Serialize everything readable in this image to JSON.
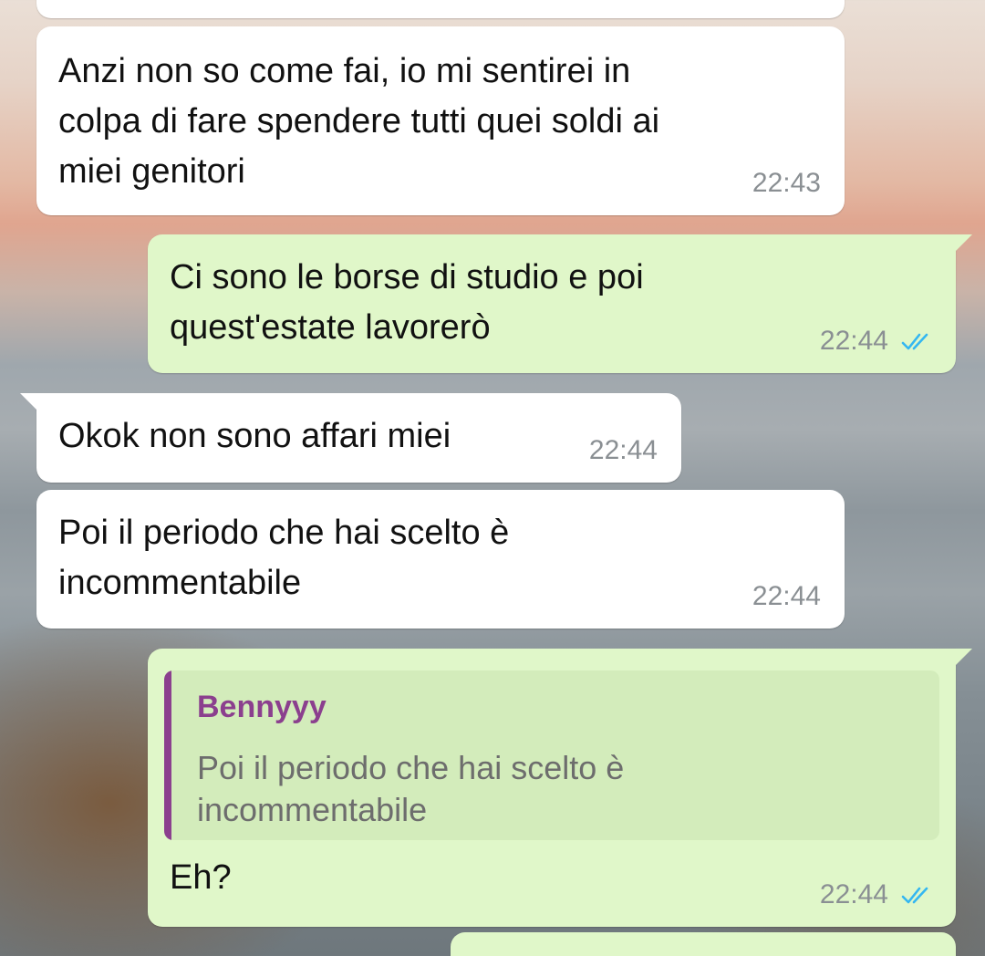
{
  "messages": [
    {
      "direction": "incoming",
      "text": "Anzi non so come fai, io mi sentirei in\ncolpa di fare spendere tutti quei soldi ai\nmiei genitori",
      "time": "22:43"
    },
    {
      "direction": "outgoing",
      "text": "Ci sono le borse di studio e poi\nquest'estate lavorerò",
      "time": "22:44",
      "status": "read"
    },
    {
      "direction": "incoming",
      "text": "Okok non sono affari miei",
      "time": "22:44"
    },
    {
      "direction": "incoming",
      "text": "Poi il periodo che hai scelto è\nincommentabile",
      "time": "22:44"
    },
    {
      "direction": "outgoing",
      "reply_to": {
        "author": "Bennyyy",
        "text": "Poi il periodo che hai scelto è\nincommentabile"
      },
      "text": "Eh?",
      "time": "22:44",
      "status": "read"
    }
  ],
  "colors": {
    "incoming_bubble": "#ffffff",
    "outgoing_bubble": "#e0f7c9",
    "quote_accent": "#8b3f8e",
    "read_ticks": "#34b7f1",
    "timestamp": "#8a8f93"
  },
  "icons": {
    "read_status": "double-check-icon"
  }
}
